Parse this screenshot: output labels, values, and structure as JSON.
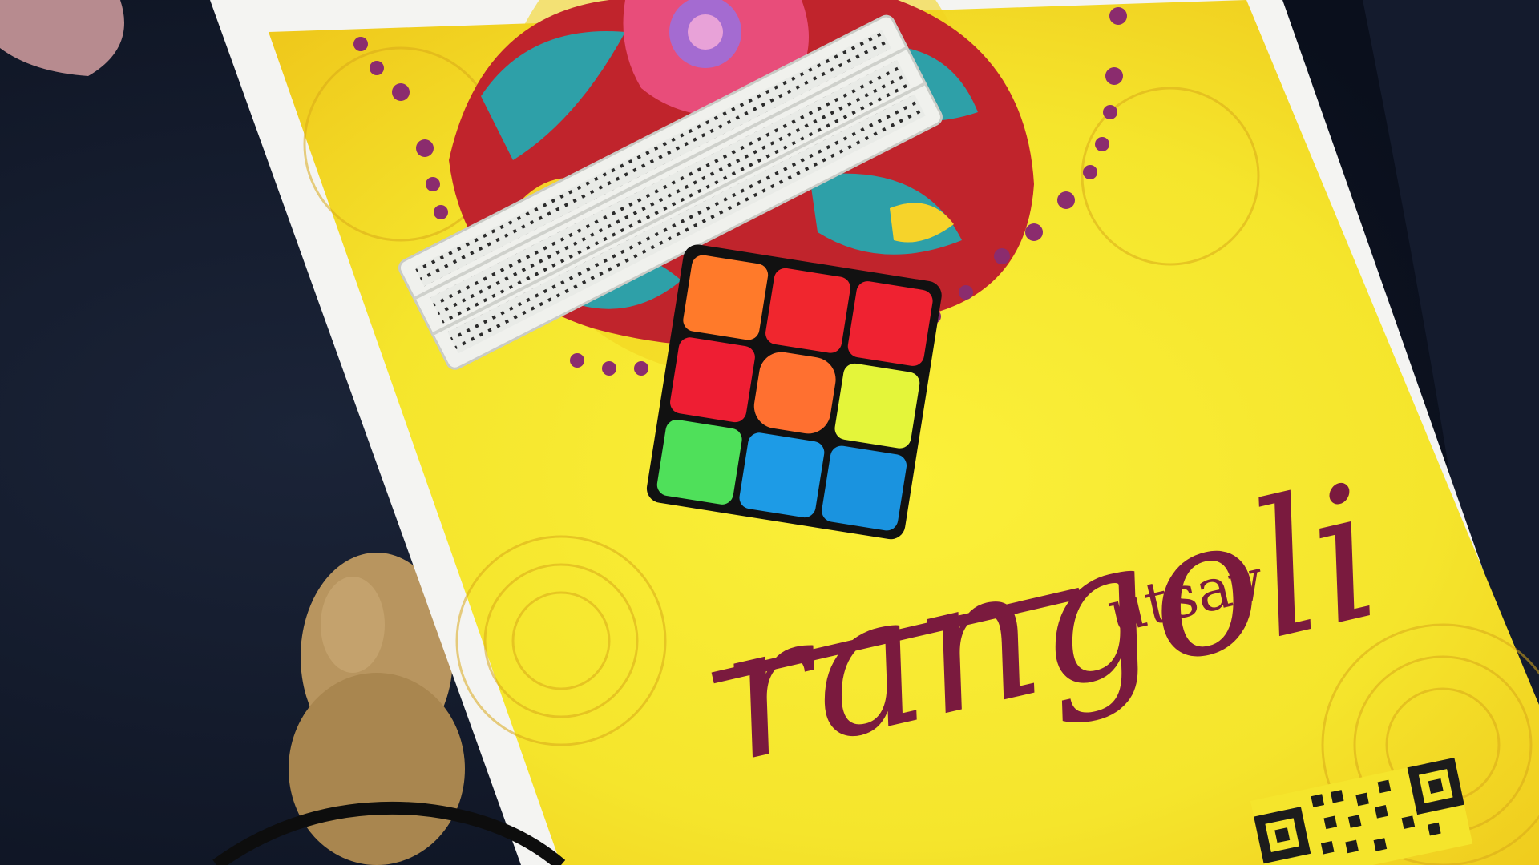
{
  "poster": {
    "logo_main": "rangoli",
    "logo_sub": "utsav"
  },
  "colors": {
    "background_cloth": "#0f1526",
    "paper_white": "#f4f4f2",
    "poster_yellow": "#f5e52c",
    "poster_orange": "#f2c21e",
    "logo_maroon": "#7a1a3e",
    "mandala_red": "#c0242c",
    "mandala_teal": "#2ea0a8",
    "breadboard_white": "#e9ebe7",
    "cube_orange": "#ff7a2a",
    "cube_red": "#f0262e",
    "cube_yellow": "#e4f53a",
    "cube_green": "#4fe05a",
    "cube_blue": "#1d9be6"
  },
  "objects": [
    "dark-cloth-background",
    "yellow-rangoli-poster",
    "mandala-artwork",
    "solderless-breadboard",
    "rubiks-cube",
    "qr-code",
    "plush-toy",
    "cable"
  ],
  "cube_faces": {
    "rows": [
      [
        "orange",
        "red",
        "red"
      ],
      [
        "red",
        "orange",
        "yellow"
      ],
      [
        "green",
        "blue",
        "blue"
      ]
    ]
  }
}
